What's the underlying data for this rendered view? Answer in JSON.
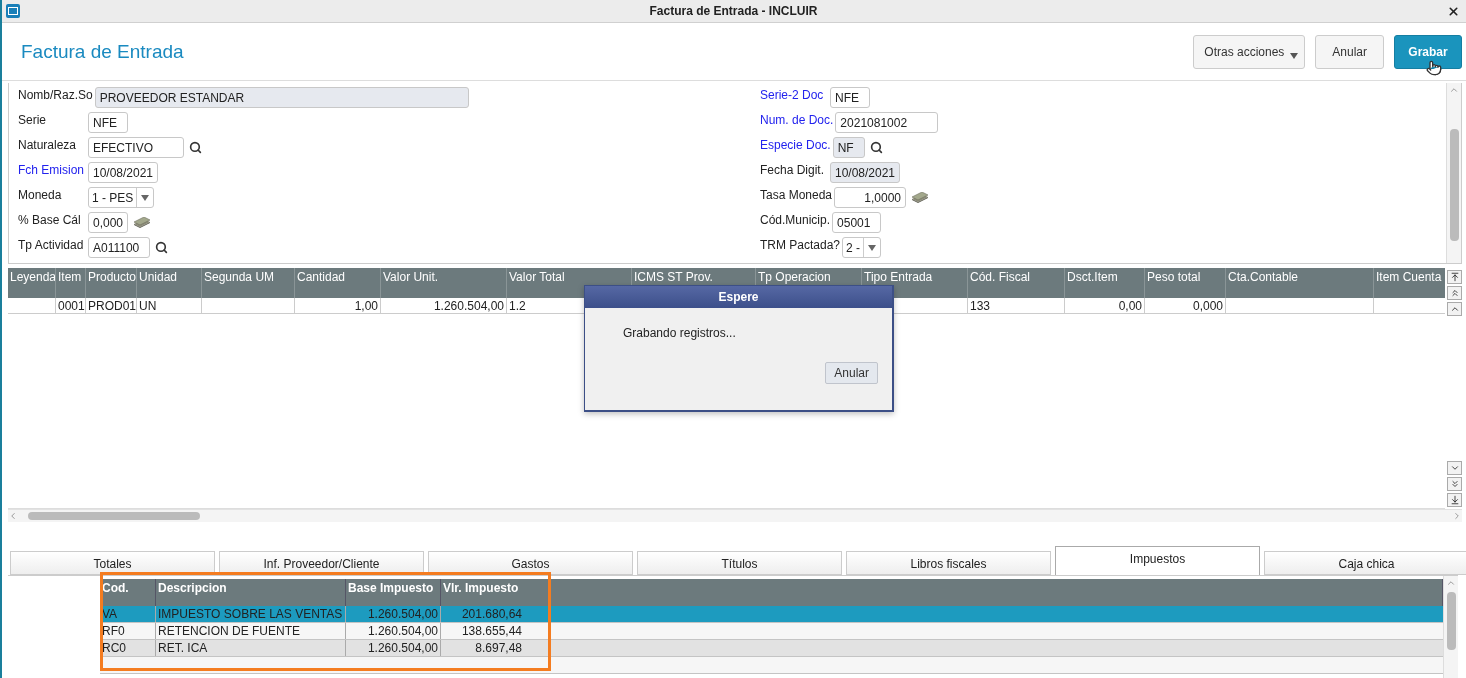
{
  "window": {
    "title": "Factura de Entrada - INCLUIR"
  },
  "header": {
    "title": "Factura de Entrada",
    "buttons": [
      {
        "label": "Otras acciones",
        "kind": "menu"
      },
      {
        "label": "Anular",
        "kind": "plain"
      },
      {
        "label": "Grabar",
        "kind": "primary"
      }
    ]
  },
  "form": {
    "left": [
      {
        "label": "Nomb/Raz.So",
        "value": "PROVEEDOR ESTANDAR",
        "kind": "wide",
        "required": false,
        "readonly": true
      },
      {
        "label": "Serie",
        "value": "NFE",
        "kind": "text",
        "required": false,
        "readonly": false
      },
      {
        "label": "Naturaleza",
        "value": "EFECTIVO",
        "kind": "lookup-long",
        "required": false,
        "readonly": false
      },
      {
        "label": "Fch Emision",
        "value": "10/08/2021",
        "kind": "date",
        "required": true,
        "readonly": false
      },
      {
        "label": "Moneda",
        "value": "1 - PES",
        "kind": "select",
        "required": false,
        "readonly": false
      },
      {
        "label": "% Base Cál",
        "value": "0,000",
        "kind": "rate",
        "required": false,
        "readonly": false
      },
      {
        "label": "Tp Actividad",
        "value": "A011100",
        "kind": "lookup",
        "required": false,
        "readonly": false
      }
    ],
    "right": [
      {
        "label": "Serie-2 Doc",
        "value": "NFE",
        "kind": "text",
        "required": true,
        "readonly": false
      },
      {
        "label": "Num. de Doc.",
        "value": "2021081002",
        "kind": "long",
        "required": true,
        "readonly": false
      },
      {
        "label": "Especie Doc.",
        "value": "NF",
        "kind": "lookup",
        "required": true,
        "readonly": true
      },
      {
        "label": "Fecha Digit.",
        "value": "10/08/2021",
        "kind": "date",
        "required": false,
        "readonly": true
      },
      {
        "label": "Tasa Moneda",
        "value": "1,0000",
        "kind": "amount",
        "required": false,
        "readonly": false
      },
      {
        "label": "Cód.Municip.",
        "value": "05001",
        "kind": "text",
        "required": false,
        "readonly": false
      },
      {
        "label": "TRM Pactada?",
        "value": "2 -",
        "kind": "select",
        "required": false,
        "readonly": false
      }
    ]
  },
  "items_grid": {
    "columns": [
      "Leyenda",
      "Item",
      "Producto",
      "Unidad",
      "Segunda UM",
      "Cantidad",
      "Valor Unit.",
      "Valor Total",
      "ICMS ST Prov.",
      "Tp Operacion",
      "Tipo Entrada",
      "Cód. Fiscal",
      "Dsct.Item",
      "Peso total",
      "Cta.Contable",
      "Item Cuenta"
    ],
    "rows": [
      {
        "cells": [
          null,
          "0001",
          "PROD01",
          "UN",
          null,
          "1,00",
          "1.260.504,00",
          "1.2",
          null,
          null,
          null,
          "133",
          "0,00",
          "0,000",
          null,
          null
        ]
      }
    ]
  },
  "dialog": {
    "title": "Espere",
    "message": "Grabando registros...",
    "button": "Anular"
  },
  "tabs": [
    {
      "label": "Totales",
      "selected": false
    },
    {
      "label": "Inf. Proveedor/Cliente",
      "selected": false
    },
    {
      "label": "Gastos",
      "selected": false
    },
    {
      "label": "Títulos",
      "selected": false
    },
    {
      "label": "Libros fiscales",
      "selected": false
    },
    {
      "label": "Impuestos",
      "selected": true
    },
    {
      "label": "Caja chica",
      "selected": false
    }
  ],
  "tax_grid": {
    "columns": [
      "Cod.",
      "Descripcion",
      "Base Impuesto",
      "Vlr. Impuesto"
    ],
    "rows": [
      {
        "cells": [
          "VA",
          "IMPUESTO SOBRE LAS VENTAS",
          "1.260.504,00",
          "201.680,64"
        ],
        "selected": true
      },
      {
        "cells": [
          "RF0",
          "RETENCION DE FUENTE",
          "1.260.504,00",
          "138.655,44"
        ],
        "selected": false
      },
      {
        "cells": [
          "RC0",
          "RET. ICA",
          "1.260.504,00",
          "8.697,48"
        ],
        "selected": false
      }
    ]
  }
}
